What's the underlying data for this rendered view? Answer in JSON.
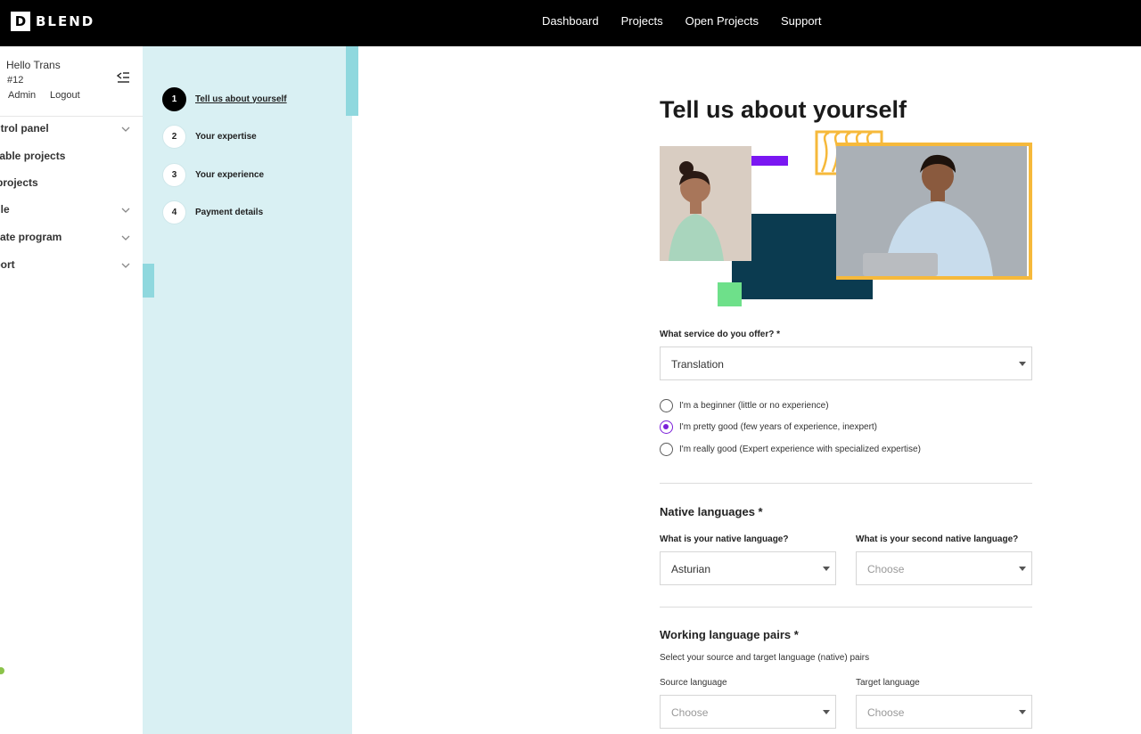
{
  "brand": {
    "logo_letter": "D",
    "name": "BLEND"
  },
  "topnav": [
    "Dashboard",
    "Projects",
    "Open Projects",
    "Support"
  ],
  "user": {
    "greeting": "Hello Trans",
    "id": "#12",
    "admin_label": "Admin",
    "logout_label": "Logout"
  },
  "sidebar": {
    "items": [
      {
        "label": "ontrol panel",
        "has_chevron": true
      },
      {
        "label": "ailable projects",
        "has_chevron": false
      },
      {
        "label": "y projects",
        "has_chevron": false
      },
      {
        "label": "ofile",
        "has_chevron": true
      },
      {
        "label": "filiate program",
        "has_chevron": true
      },
      {
        "label": "pport",
        "has_chevron": true
      }
    ]
  },
  "steps": [
    {
      "num": "1",
      "label": "Tell us about yourself",
      "active": true
    },
    {
      "num": "2",
      "label": "Your expertise",
      "active": false
    },
    {
      "num": "3",
      "label": "Your experience",
      "active": false
    },
    {
      "num": "4",
      "label": "Payment details",
      "active": false
    }
  ],
  "main": {
    "title": "Tell us about yourself",
    "service": {
      "label": "What service do you offer? *",
      "value": "Translation"
    },
    "levels": [
      {
        "label": "I'm a beginner (little or no experience)",
        "checked": false
      },
      {
        "label": "I'm pretty good (few years of experience, inexpert)",
        "checked": true
      },
      {
        "label": "I'm really good (Expert experience with specialized expertise)",
        "checked": false
      }
    ],
    "native": {
      "title": "Native languages *",
      "first_label": "What is your native language?",
      "first_value": "Asturian",
      "second_label": "What is your second native language?",
      "second_placeholder": "Choose"
    },
    "pairs": {
      "title": "Working language pairs *",
      "hint": "Select your source and target language (native) pairs",
      "source_label": "Source language",
      "source_placeholder": "Choose",
      "target_label": "Target language",
      "target_placeholder": "Choose"
    }
  },
  "colors": {
    "topbar": "#000000",
    "steps_panel": "#d9f0f3",
    "steps_accent": "#8fd8de",
    "radio_checked": "#7b1fd9",
    "collage_purple": "#7a17f2",
    "collage_navy": "#0b3b50",
    "collage_gold": "#f6b93b",
    "collage_green": "#6ee08a"
  }
}
